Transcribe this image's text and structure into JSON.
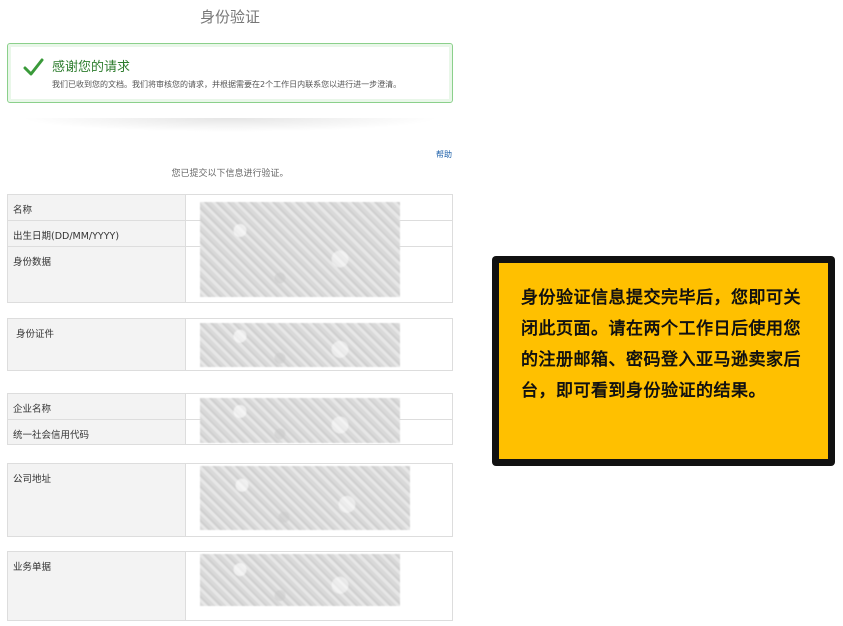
{
  "page_title": "身份验证",
  "success": {
    "title": "感谢您的请求",
    "message": "我们已收到您的文档。我们将审核您的请求，并根据需要在2个工作日内联系您以进行进一步澄清。"
  },
  "help_label": "帮助",
  "submitted_note": "您已提交以下信息进行验证。",
  "personal_info": {
    "rows": [
      "名称",
      "出生日期(DD/MM/YYYY)",
      "身份数据"
    ]
  },
  "id_document": {
    "label": "身份证件"
  },
  "business_info": {
    "rows": [
      "企业名称",
      "统一社会信用代码"
    ]
  },
  "company_address": {
    "label": "公司地址"
  },
  "business_doc": {
    "label": "业务单据"
  },
  "callout": {
    "text": "身份验证信息提交完毕后，您即可关闭此页面。请在两个工作日后使用您的注册邮箱、密码登入亚马逊卖家后台，即可看到身份验证的结果。"
  },
  "colors": {
    "success_border": "#8bd08b",
    "success_title": "#2e7d2e",
    "callout_bg": "#ffc000",
    "callout_border": "#111111",
    "link": "#1a5ea8"
  }
}
